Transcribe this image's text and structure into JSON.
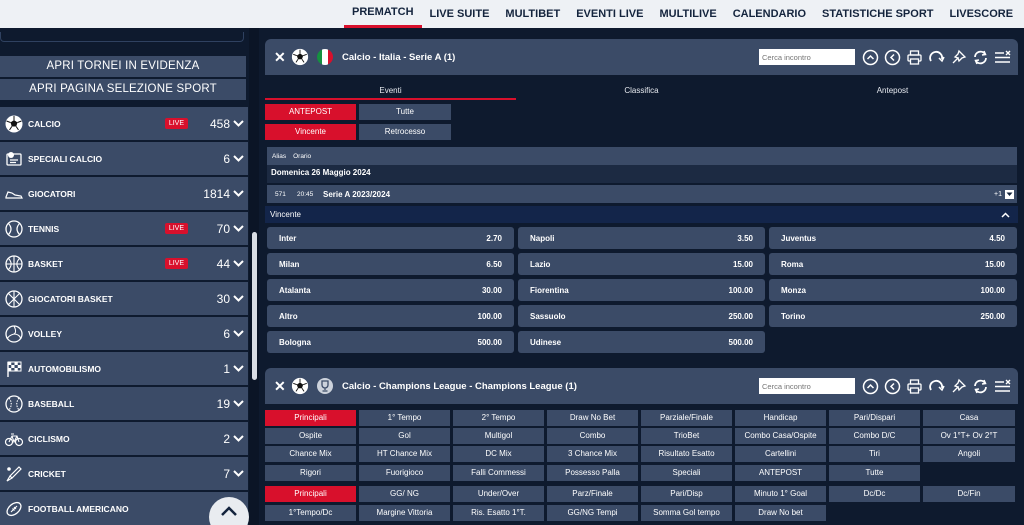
{
  "topnav": {
    "items": [
      "PREMATCH",
      "LIVE SUITE",
      "MULTIBET",
      "EVENTI LIVE",
      "MULTILIVE",
      "CALENDARIO",
      "STATISTICHE SPORT",
      "LIVESCORE"
    ]
  },
  "sidebar": {
    "btn_tornei": "APRI TORNEI IN EVIDENZA",
    "btn_sport": "APRI PAGINA SELEZIONE SPORT",
    "live_label": "LIVE",
    "sports": [
      {
        "name": "CALCIO",
        "count": "458",
        "live": true,
        "icon": "soccer-ball-icon"
      },
      {
        "name": "SPECIALI CALCIO",
        "count": "6",
        "live": false,
        "icon": "special-soccer-icon"
      },
      {
        "name": "GIOCATORI",
        "count": "1814",
        "live": false,
        "icon": "shoe-icon"
      },
      {
        "name": "TENNIS",
        "count": "70",
        "live": true,
        "icon": "tennis-ball-icon"
      },
      {
        "name": "BASKET",
        "count": "44",
        "live": true,
        "icon": "basketball-icon"
      },
      {
        "name": "GIOCATORI BASKET",
        "count": "30",
        "live": false,
        "icon": "basketball-player-icon"
      },
      {
        "name": "VOLLEY",
        "count": "6",
        "live": false,
        "icon": "volleyball-icon"
      },
      {
        "name": "AUTOMOBILISMO",
        "count": "1",
        "live": false,
        "icon": "checkered-flag-icon"
      },
      {
        "name": "BASEBALL",
        "count": "19",
        "live": false,
        "icon": "baseball-icon"
      },
      {
        "name": "CICLISMO",
        "count": "2",
        "live": false,
        "icon": "bicycle-icon"
      },
      {
        "name": "CRICKET",
        "count": "7",
        "live": false,
        "icon": "cricket-bat-icon"
      },
      {
        "name": "FOOTBALL AMERICANO",
        "count": "",
        "live": false,
        "icon": "american-football-icon"
      }
    ]
  },
  "panel1": {
    "title": "Calcio - Italia - Serie A (1)",
    "search_placeholder": "Cerca incontro",
    "tabs": [
      "Eventi",
      "Classifica",
      "Antepost"
    ],
    "filter_row1": [
      "ANTEPOST",
      "Tutte"
    ],
    "filter_row2": [
      "Vincente",
      "Retrocesso"
    ],
    "alias_label": "Alias",
    "orario_label": "Orario",
    "date": "Domenica 26 Maggio 2024",
    "event": {
      "code": "571",
      "time": "20:45",
      "name": "Serie A 2023/2024",
      "more": "+1"
    },
    "market": "Vincente",
    "odds": [
      {
        "team": "Inter",
        "odd": "2.70"
      },
      {
        "team": "Napoli",
        "odd": "3.50"
      },
      {
        "team": "Juventus",
        "odd": "4.50"
      },
      {
        "team": "Milan",
        "odd": "6.50"
      },
      {
        "team": "Lazio",
        "odd": "15.00"
      },
      {
        "team": "Roma",
        "odd": "15.00"
      },
      {
        "team": "Atalanta",
        "odd": "30.00"
      },
      {
        "team": "Fiorentina",
        "odd": "100.00"
      },
      {
        "team": "Monza",
        "odd": "100.00"
      },
      {
        "team": "Altro",
        "odd": "100.00"
      },
      {
        "team": "Sassuolo",
        "odd": "250.00"
      },
      {
        "team": "Torino",
        "odd": "250.00"
      },
      {
        "team": "Bologna",
        "odd": "500.00"
      },
      {
        "team": "Udinese",
        "odd": "500.00"
      }
    ]
  },
  "panel2": {
    "title": "Calcio - Champions League - Champions League (1)",
    "search_placeholder": "Cerca incontro",
    "row1": [
      "Principali",
      "1° Tempo",
      "2° Tempo",
      "Draw No Bet",
      "Parziale/Finale",
      "Handicap",
      "Pari/Dispari",
      "Casa"
    ],
    "row2": [
      "Ospite",
      "Gol",
      "Multigol",
      "Combo",
      "TrioBet",
      "Combo Casa/Ospite",
      "Combo D/C",
      "Ov 1°T+ Ov 2°T"
    ],
    "row3": [
      "Chance Mix",
      "HT Chance Mix",
      "DC Mix",
      "3 Chance Mix",
      "Risultato Esatto",
      "Cartellini",
      "Tiri",
      "Angoli"
    ],
    "row4": [
      "Rigori",
      "Fuorigioco",
      "Falli Commessi",
      "Possesso Palla",
      "Speciali",
      "ANTEPOST",
      "Tutte"
    ],
    "row5": [
      "Principali",
      "GG/ NG",
      "Under/Over",
      "Parz/Finale",
      "Pari/Disp",
      "Minuto 1° Goal",
      "Dc/Dc",
      "Dc/Fin"
    ],
    "row6": [
      "1°Tempo/Dc",
      "Margine Vittoria",
      "Ris. Esatto 1°T.",
      "GG/NG Tempi",
      "Somma Gol tempo",
      "Draw No bet"
    ]
  }
}
